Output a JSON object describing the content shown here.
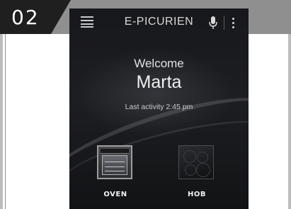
{
  "step": {
    "number": "02"
  },
  "app": {
    "title": "E-PICURIEN",
    "menu_icon": "hamburger-menu-icon",
    "mic_icon": "microphone-icon",
    "more_icon": "more-vertical-icon"
  },
  "greeting": {
    "welcome": "Welcome",
    "user_name": "Marta",
    "last_activity": "Last activity 2:45 pm"
  },
  "appliances": [
    {
      "label": "OVEN",
      "icon": "oven-icon"
    },
    {
      "label": "HOB",
      "icon": "hob-icon"
    }
  ],
  "colors": {
    "screen_background": "#111214",
    "frame_band": "#8f8f8f",
    "step_tab": "#1f1f1f",
    "text_light": "#e2e2e2"
  }
}
